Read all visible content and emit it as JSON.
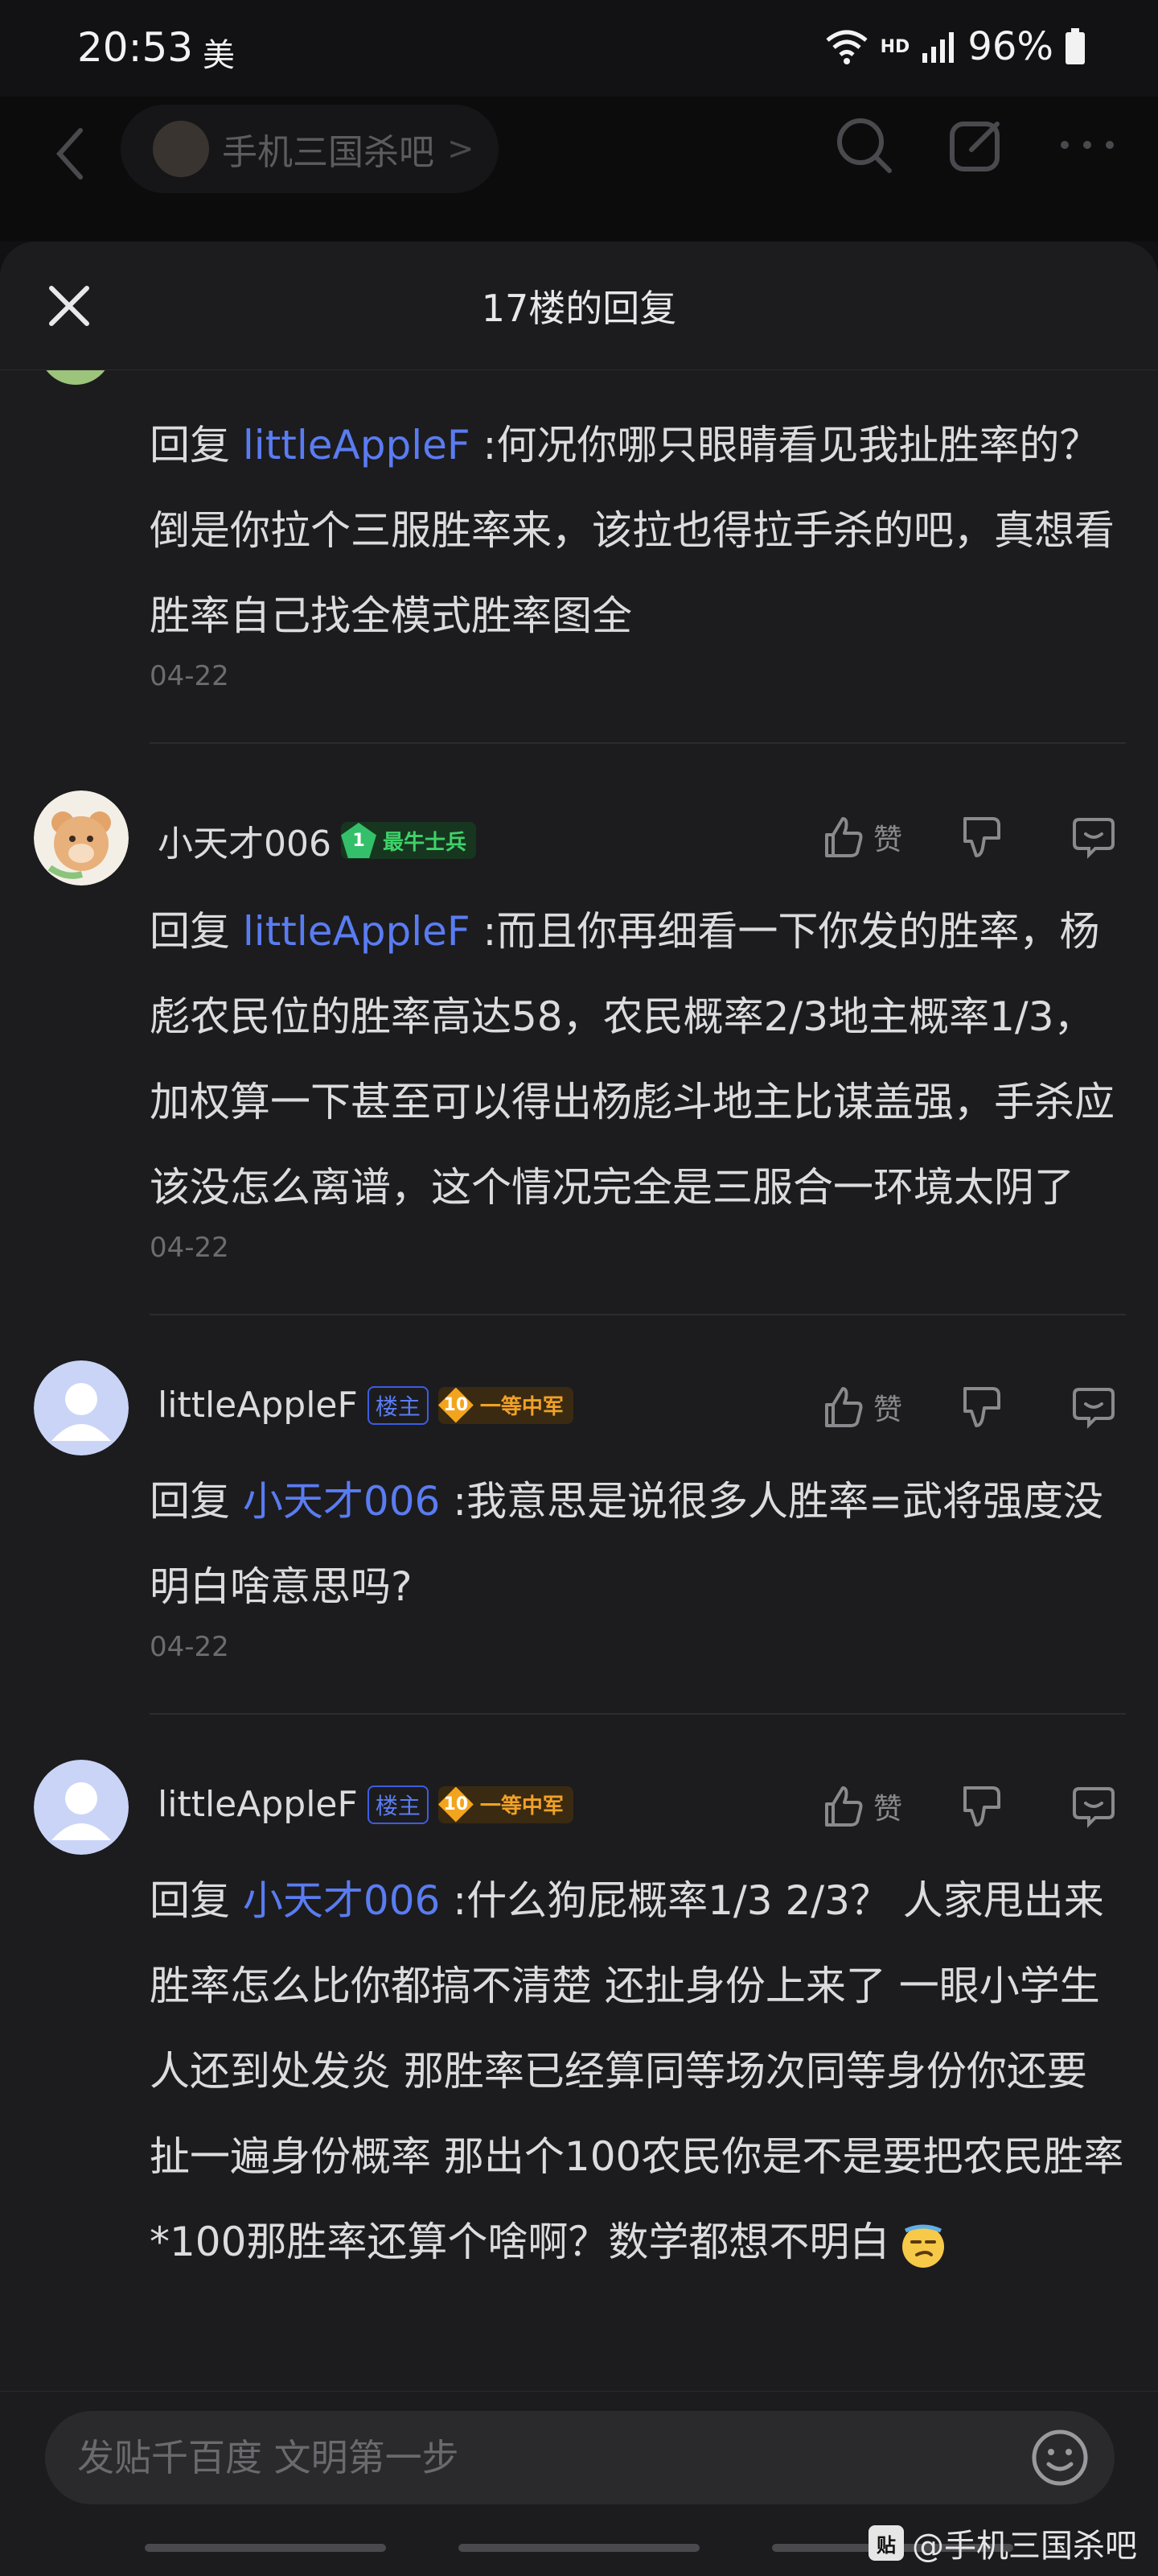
{
  "status_bar": {
    "time": "20:53",
    "carrier": "美",
    "hd": "HD",
    "battery": "96%"
  },
  "underlying_header": {
    "forum_name": "手机三国杀吧",
    "chevron": ">"
  },
  "sheet": {
    "title": "17楼的回复"
  },
  "top_reply": {
    "reply_prefix": "回复",
    "mention": "littleAppleF",
    "text": " :何况你哪只眼睛看见我扯胜率的？倒是你拉个三服胜率来，该拉也得拉手杀的吧，真想看胜率自己找全模式胜率图全",
    "date": "04-22"
  },
  "comments": [
    {
      "username": "小天才006",
      "level": "1",
      "level_title": "最牛士兵",
      "owner_badge": "",
      "like_label": "赞",
      "reply_prefix": "回复",
      "mention": "littleAppleF",
      "text": " :而且你再细看一下你发的胜率，杨彪农民位的胜率高达58，农民概率2/3地主概率1/3，加权算一下甚至可以得出杨彪斗地主比谋盖强，手杀应该没怎么离谱，这个情况完全是三服合一环境太阴了",
      "date": "04-22"
    },
    {
      "username": "littleAppleF",
      "level": "10",
      "level_title": "一等中军",
      "owner_badge": "楼主",
      "like_label": "赞",
      "reply_prefix": "回复",
      "mention": "小天才006",
      "text": " :我意思是说很多人胜率=武将强度没明白啥意思吗?",
      "date": "04-22"
    },
    {
      "username": "littleAppleF",
      "level": "10",
      "level_title": "一等中军",
      "owner_badge": "楼主",
      "like_label": "赞",
      "reply_prefix": "回复",
      "mention": "小天才006",
      "text": " :什么狗屁概率1/3 2/3？ 人家甩出来胜率怎么比你都搞不清楚 还扯身份上来了 一眼小学生人还到处发炎 那胜率已经算同等场次同等身份你还要扯一遍身份概率 那出个100农民你是不是要把农民胜率*100那胜率还算个啥啊？数学都想不明白"
    }
  ],
  "input": {
    "placeholder": "发贴千百度 文明第一步"
  },
  "watermark": {
    "box": "贴",
    "text": "@手机三国杀吧"
  },
  "colors": {
    "mention": "#5a7cf2",
    "background": "#1c1c1e",
    "level_green": "#3fd26a",
    "level_gold": "#f0a127"
  }
}
